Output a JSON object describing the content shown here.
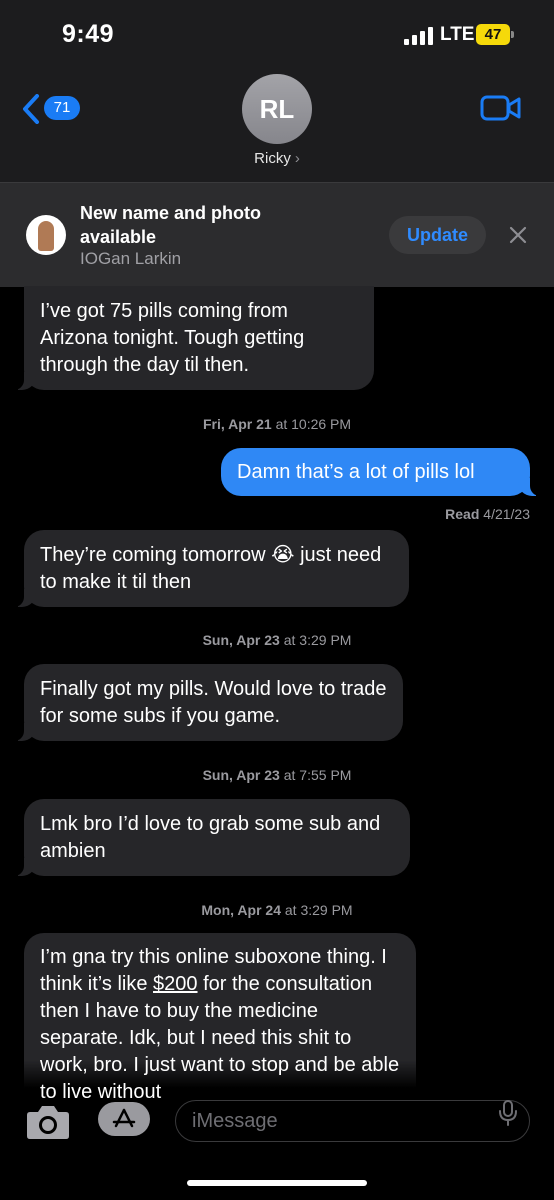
{
  "status_bar": {
    "time": "9:49",
    "network": "LTE",
    "battery": "47"
  },
  "header": {
    "back_count": "71",
    "avatar_initials": "RL",
    "contact_name": "Ricky",
    "name_chevron": "›",
    "icons": {
      "back": "chevron-left-icon",
      "video": "video-camera-icon"
    }
  },
  "banner": {
    "title": "New name and photo available",
    "subtitle": "IOGan Larkin",
    "update_label": "Update"
  },
  "messages": [
    {
      "side": "in",
      "text": "I’ve got 75 pills coming from Arizona tonight. Tough getting through the day til then."
    },
    {
      "side": "timestamp",
      "day": "Fri, Apr 21",
      "time": "at 10:26 PM"
    },
    {
      "side": "out",
      "text": "Damn that’s a lot of pills lol"
    },
    {
      "side": "read",
      "label": "Read",
      "date": "4/21/23"
    },
    {
      "side": "in",
      "text": "They’re coming tomorrow 😭 just need to make it til then"
    },
    {
      "side": "timestamp",
      "day": "Sun, Apr 23",
      "time": "at 3:29 PM"
    },
    {
      "side": "in",
      "text": "Finally got my pills. Would love to trade for some subs if you game."
    },
    {
      "side": "timestamp",
      "day": "Sun, Apr 23",
      "time": "at 7:55 PM"
    },
    {
      "side": "in",
      "text": "Lmk bro I’d love to grab some sub and ambien"
    },
    {
      "side": "timestamp",
      "day": "Mon, Apr 24",
      "time": "at 3:29 PM"
    },
    {
      "side": "in",
      "text_before": "I’m gna try this online suboxone thing. I think it’s like ",
      "link": "$200",
      "text_after": " for the consultation then I have to buy the medicine separate. Idk, but I need this shit to work, bro. I just want to stop and be able to live without"
    }
  ],
  "input": {
    "placeholder": "iMessage"
  },
  "colors": {
    "incoming": "#262629",
    "outgoing": "#2f88f5",
    "accent": "#1a7cf5",
    "battery": "#f5d90a"
  }
}
